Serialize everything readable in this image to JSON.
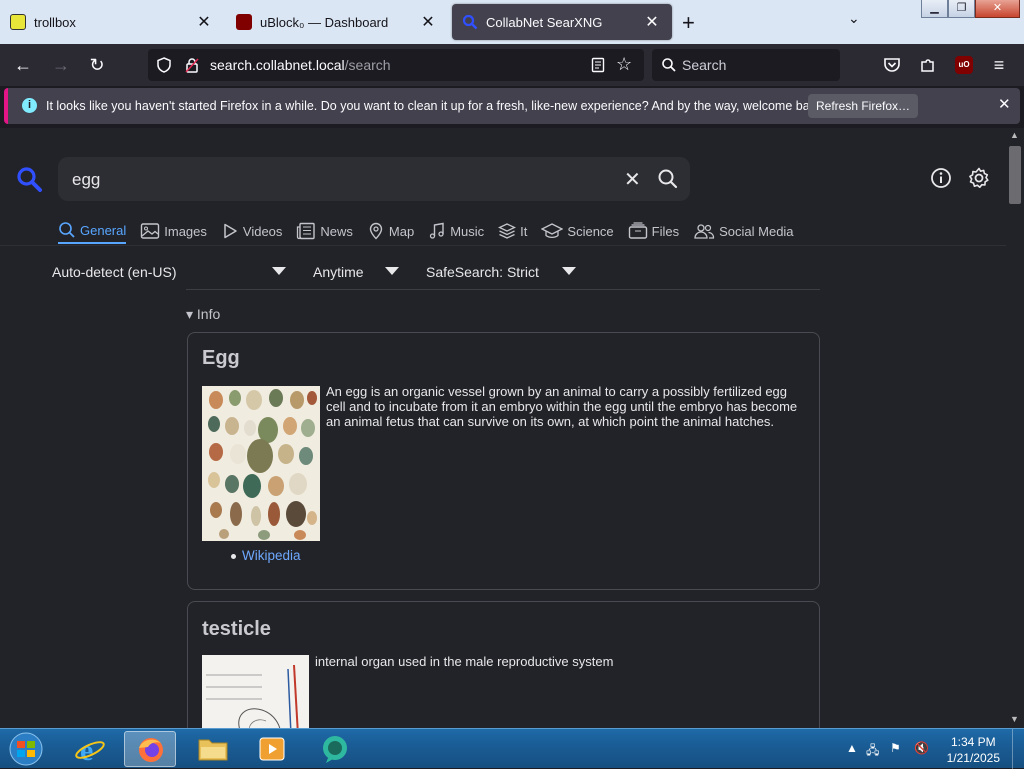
{
  "browser": {
    "tabs": [
      {
        "title": "trollbox",
        "favicon": "trollbox-favicon",
        "active": false
      },
      {
        "title": "uBlock₀ — Dashboard",
        "favicon": "ublock-favicon",
        "active": false
      },
      {
        "title": "CollabNet SearXNG",
        "favicon": "search-favicon",
        "active": true
      }
    ],
    "new_tab_label": "+",
    "url_host": "search.collabnet.local",
    "url_path": "/search",
    "search_placeholder": "Search"
  },
  "notification": {
    "message": "It looks like you haven't started Firefox in a while. Do you want to clean it up for a fresh, like-new experience? And by the way, welcome back!",
    "button_label": "Refresh Firefox…"
  },
  "search": {
    "query": "egg",
    "categories": [
      {
        "label": "General",
        "icon": "search-icon",
        "active": true
      },
      {
        "label": "Images",
        "icon": "image-icon"
      },
      {
        "label": "Videos",
        "icon": "play-icon"
      },
      {
        "label": "News",
        "icon": "newspaper-icon"
      },
      {
        "label": "Map",
        "icon": "map-pin-icon"
      },
      {
        "label": "Music",
        "icon": "music-note-icon"
      },
      {
        "label": "It",
        "icon": "layers-icon"
      },
      {
        "label": "Science",
        "icon": "graduation-cap-icon"
      },
      {
        "label": "Files",
        "icon": "files-icon"
      },
      {
        "label": "Social Media",
        "icon": "people-icon"
      }
    ],
    "filters": {
      "language": "Auto-detect (en-US)",
      "time": "Anytime",
      "safesearch": "SafeSearch: Strict"
    },
    "info_toggle": "▾ Info"
  },
  "infoboxes": [
    {
      "title": "Egg",
      "description": "An egg is an organic vessel grown by an animal to carry a possibly fertilized egg cell and to incubate from it an embryo within the egg until the embryo has become an animal fetus that can survive on its own, at which point the animal hatches.",
      "link": "Wikipedia"
    },
    {
      "title": "testicle",
      "description": "internal organ used in the male reproductive system"
    }
  ],
  "taskbar": {
    "time": "1:34 PM",
    "date": "1/21/2025"
  },
  "colors": {
    "accent": "#58a6ff",
    "link": "#6ea8fe",
    "page_bg": "#222328",
    "notification_accent": "#e31587"
  }
}
